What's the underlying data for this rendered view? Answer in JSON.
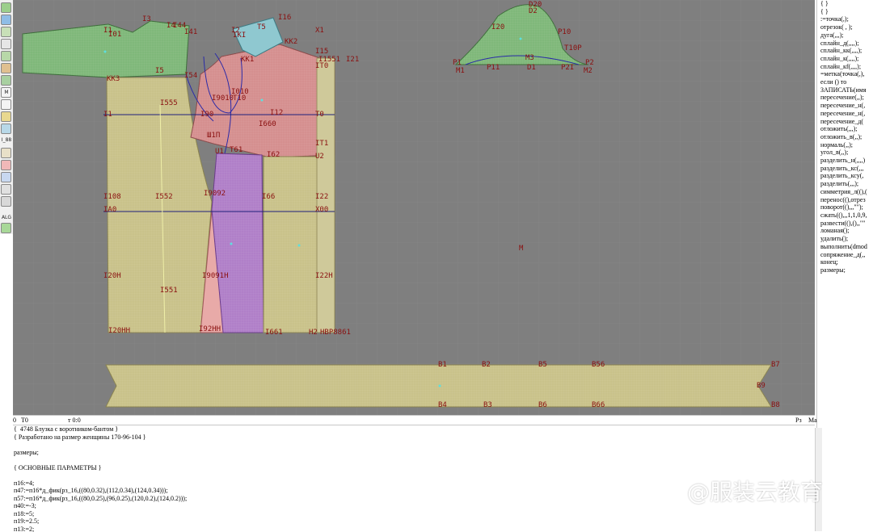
{
  "toolbar": {
    "label_1": "I_88",
    "label_2": "M",
    "label_3": "ALG"
  },
  "colors": {
    "canvas_bg": "#7f7f7f",
    "green_piece": "#7fb87a",
    "yellow_piece": "#c9c28a",
    "red_piece": "#d58f8f",
    "purple_piece": "#b07fc8",
    "pink_piece": "#e8aaa8",
    "cyan_piece": "#8fc8d0",
    "label": "#8a1010"
  },
  "canvas": {
    "center_mark": "M",
    "labels": [
      {
        "text": "I3"
      },
      {
        "text": "I1"
      },
      {
        "text": "I01"
      },
      {
        "text": "I4"
      },
      {
        "text": "I44"
      },
      {
        "text": "I41"
      },
      {
        "text": "I5"
      },
      {
        "text": "KK3"
      },
      {
        "text": "I54"
      },
      {
        "text": "I555"
      },
      {
        "text": "I1"
      },
      {
        "text": "I2"
      },
      {
        "text": "IKI"
      },
      {
        "text": "T5"
      },
      {
        "text": "I16"
      },
      {
        "text": "KK2"
      },
      {
        "text": "X1"
      },
      {
        "text": "KK1"
      },
      {
        "text": "I15"
      },
      {
        "text": "I1551"
      },
      {
        "text": "I21"
      },
      {
        "text": "IT0"
      },
      {
        "text": "I010"
      },
      {
        "text": "I9010"
      },
      {
        "text": "T10"
      },
      {
        "text": "I90"
      },
      {
        "text": "I12"
      },
      {
        "text": "T0"
      },
      {
        "text": "I660"
      },
      {
        "text": "Ш1П"
      },
      {
        "text": "IT1"
      },
      {
        "text": "T61"
      },
      {
        "text": "I62"
      },
      {
        "text": "U1"
      },
      {
        "text": "U2"
      },
      {
        "text": "I108"
      },
      {
        "text": "I552"
      },
      {
        "text": "I9092"
      },
      {
        "text": "I66"
      },
      {
        "text": "I22"
      },
      {
        "text": "IA0"
      },
      {
        "text": "X00"
      },
      {
        "text": "I20H"
      },
      {
        "text": "I9091H"
      },
      {
        "text": "I22H"
      },
      {
        "text": "I551"
      },
      {
        "text": "I20HH"
      },
      {
        "text": "I92HH"
      },
      {
        "text": "I661"
      },
      {
        "text": "H2"
      },
      {
        "text": "HBP8861"
      },
      {
        "text": "D20"
      },
      {
        "text": "D2"
      },
      {
        "text": "I20"
      },
      {
        "text": "P10"
      },
      {
        "text": "T10P"
      },
      {
        "text": "M3"
      },
      {
        "text": "P1"
      },
      {
        "text": "M1"
      },
      {
        "text": "P11"
      },
      {
        "text": "D1"
      },
      {
        "text": "P2"
      },
      {
        "text": "M2"
      },
      {
        "text": "P2I"
      },
      {
        "text": "B1"
      },
      {
        "text": "B2"
      },
      {
        "text": "B5"
      },
      {
        "text": "B56"
      },
      {
        "text": "B7"
      },
      {
        "text": "B9"
      },
      {
        "text": "B4"
      },
      {
        "text": "B3"
      },
      {
        "text": "B6"
      },
      {
        "text": "B66"
      },
      {
        "text": "B8"
      }
    ]
  },
  "right_panel": {
    "lines": [
      "{ }",
      "{ }",
      ":=точка(,);",
      "отрезок( , );",
      "дуга(,,,);",
      "сплайн_д(,,,,);",
      "сплайн_кк(,,,,);",
      "сплайн_к(,,,,);",
      "сплайн_кf(,,,,);",
      "=метка(точка(,),",
      "если () то",
      "ЗАПИСАТЬ(имя",
      "пересечение(,,);",
      "пересечение_н(,",
      "пересечение_н(,",
      "пересечение_д(",
      "отложить(,,,);",
      "отложить_в(,,);",
      "нормаль(,,);",
      "угол_в(,,);",
      "разделить_н(,,,,)",
      "разделить_кс(,,,",
      "разделить_ксу(,",
      "разделить(,,,);",
      "симметрия_л((),(",
      "перенос((),отрез",
      "поворот((),,,\"\");",
      "сжать((),,,1,1,0,9,",
      "развести((),(),,\"\"",
      "ломаная();",
      "удалить();",
      "выполнить(dmod",
      "сопряжение_д(,,",
      "конец;",
      "размеры;"
    ]
  },
  "status": {
    "left_zero": "0",
    "left_label": "T0",
    "mid_label": "т 0:0",
    "right_label_1": "Рз",
    "right_label_2": "Ма"
  },
  "code": {
    "lines": [
      "{  4748 Блузка с воротником-бантом }",
      "{ Разработано на размер женщины 170-96-104 }",
      "",
      "размеры;",
      "",
      "{ ОСНОВНЫЕ ПАРАМЕТРЫ }",
      "",
      "п16:=4;",
      "п47:=п16*д_фик(рз_16,((80,0.32),(112,0.34),(124,0.34)));",
      "п57:=п16*д_фик(рз_16,((80,0.25),(96,0.25),(120,0.2),(124,0.2)));",
      "п40:=-3;",
      "п18:=5;",
      "п19:=2.5;",
      "п13:=2;"
    ]
  },
  "watermark": "@服装云教育"
}
